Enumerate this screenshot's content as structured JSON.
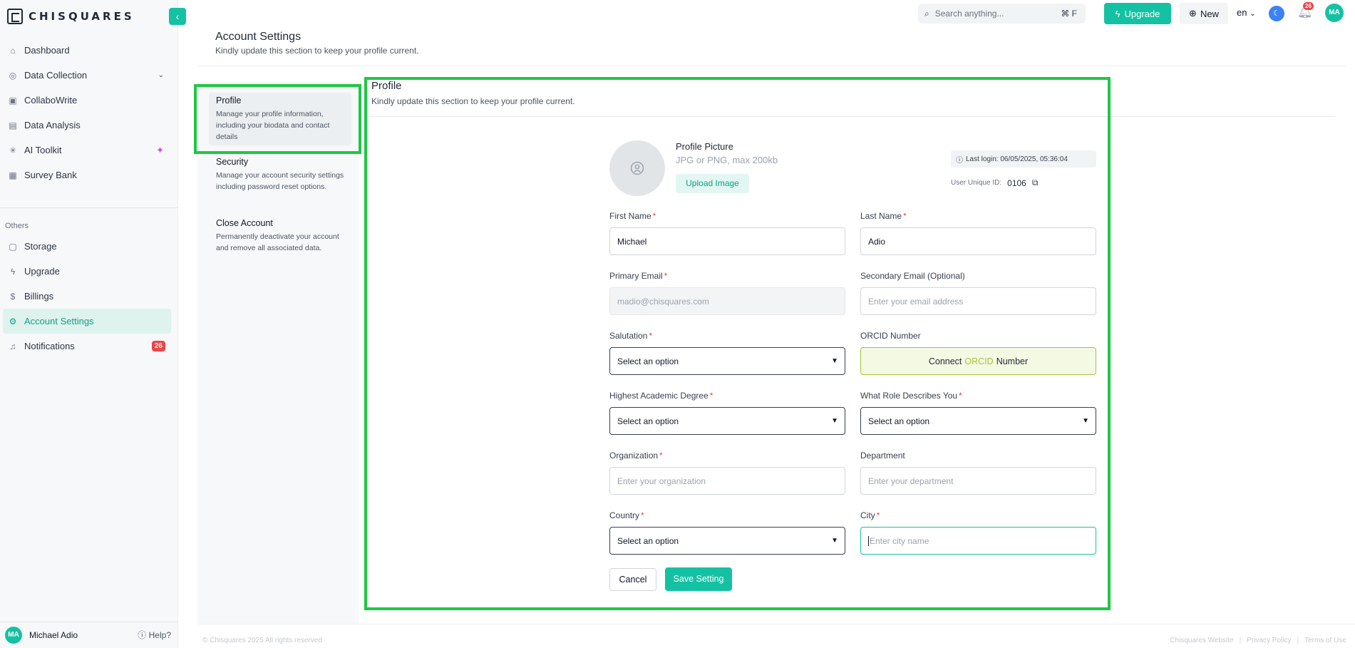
{
  "brand": {
    "name": "CHISQUARES"
  },
  "sidebar": {
    "items": [
      {
        "label": "Dashboard"
      },
      {
        "label": "Data Collection"
      },
      {
        "label": "CollaboWrite"
      },
      {
        "label": "Data Analysis"
      },
      {
        "label": "AI Toolkit"
      },
      {
        "label": "Survey Bank"
      }
    ],
    "others_label": "Others",
    "other_items": [
      {
        "label": "Storage"
      },
      {
        "label": "Upgrade"
      },
      {
        "label": "Billings"
      },
      {
        "label": "Account Settings"
      },
      {
        "label": "Notifications",
        "badge": "26"
      }
    ],
    "user": {
      "initials": "MA",
      "name": "Michael Adio"
    },
    "help_label": "Help?"
  },
  "topbar": {
    "search_placeholder": "Search anything...",
    "search_shortcut": "⌘ F",
    "upgrade_label": "Upgrade",
    "new_label": "New",
    "language": "en",
    "notification_count": "26",
    "avatar_initials": "MA"
  },
  "header": {
    "title": "Account Settings",
    "subtitle": "Kindly update this section to keep your profile current."
  },
  "settings_menu": [
    {
      "title": "Profile",
      "description": "Manage your profile information, including your biodata and contact details"
    },
    {
      "title": "Security",
      "description": "Manage your account security settings including password reset options."
    },
    {
      "title": "Close Account",
      "description": "Permanently deactivate your account and remove all associated data."
    }
  ],
  "profile": {
    "title": "Profile",
    "subtitle": "Kindly update this section to keep your profile current.",
    "picture_title": "Profile Picture",
    "picture_hint": "JPG or PNG, max 200kb",
    "upload_label": "Upload Image",
    "last_login": "Last login: 06/05/2025, 05:36:04",
    "uid_label": "User Unique ID:",
    "uid_value": "0106"
  },
  "form": {
    "first_name": {
      "label": "First Name",
      "value": "Michael"
    },
    "last_name": {
      "label": "Last Name",
      "value": "Adio"
    },
    "primary_email": {
      "label": "Primary Email",
      "value": "madio@chisquares.com"
    },
    "secondary_email": {
      "label": "Secondary Email (Optional)",
      "placeholder": "Enter your email address"
    },
    "salutation": {
      "label": "Salutation",
      "value": "Select an option"
    },
    "orcid": {
      "label": "ORCID Number",
      "connect": "Connect",
      "orcid": "ORCID",
      "number": "Number"
    },
    "degree": {
      "label": "Highest Academic Degree",
      "value": "Select an option"
    },
    "role": {
      "label": "What Role Describes You",
      "value": "Select an option"
    },
    "organization": {
      "label": "Organization",
      "placeholder": "Enter your organization"
    },
    "department": {
      "label": "Department",
      "placeholder": "Enter your department"
    },
    "country": {
      "label": "Country",
      "value": "Select an option"
    },
    "city": {
      "label": "City",
      "placeholder": "Enter city name"
    },
    "required_mark": "*",
    "cancel_label": "Cancel",
    "save_label": "Save Setting"
  },
  "footer": {
    "copyright": "© Chisquares 2025 All rights reserved",
    "links": [
      "Chisquares Website",
      "Privacy Policy",
      "Terms of Use"
    ]
  },
  "colors": {
    "accent": "#14c2a3",
    "highlight": "#1fc743",
    "danger": "#ef4444"
  }
}
